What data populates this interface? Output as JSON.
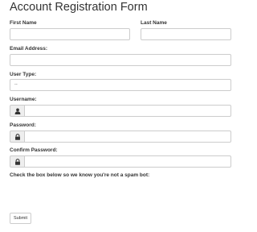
{
  "form": {
    "title": "Account Registration Form",
    "first_name_label": "First Name",
    "last_name_label": "Last Name",
    "email_label": "Email Address:",
    "user_type_label": "User Type:",
    "user_type_value": "--",
    "username_label": "Username:",
    "password_label": "Password:",
    "confirm_password_label": "Confirm Password:",
    "spam_note": "Check the box below so we know you're not a spam bot:",
    "submit_label": "Submit"
  },
  "icons": {
    "username_addon": "user-icon",
    "password_addon": "lock-icon",
    "confirm_password_addon": "lock-icon"
  }
}
